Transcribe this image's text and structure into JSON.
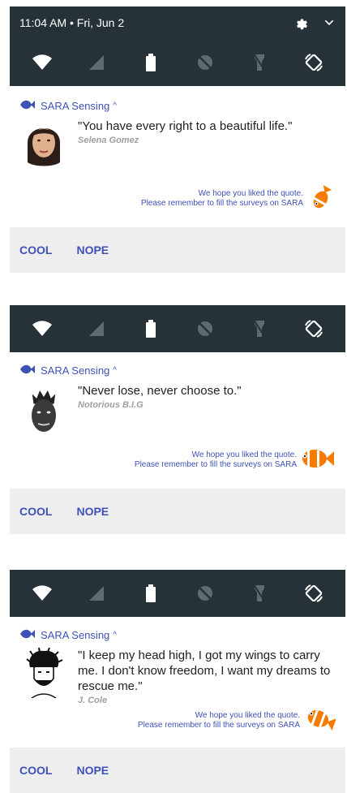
{
  "status": {
    "time": "11:04 AM • Fri, Jun 2"
  },
  "notifications": [
    {
      "app_name": "SARA Sensing",
      "quote": "\"You have every right to a beautiful life.\"",
      "author": "Selena Gomez",
      "footer_line1": "We hope you liked the quote.",
      "footer_line2": "Please remember to fill the surveys on SARA",
      "actions": [
        "COOL",
        "NOPE"
      ]
    },
    {
      "app_name": "SARA Sensing",
      "quote": "\"Never lose, never choose to.\"",
      "author": "Notorious B.I.G",
      "footer_line1": "We hope you liked the quote.",
      "footer_line2": "Please remember to fill the surveys on SARA",
      "actions": [
        "COOL",
        "NOPE"
      ]
    },
    {
      "app_name": "SARA Sensing",
      "quote": "\"I keep my head high, I got my wings to carry me. I don't know freedom, I want my dreams to rescue me.\"",
      "author": "J. Cole",
      "footer_line1": "We hope you liked the quote.",
      "footer_line2": "Please remember to fill the surveys on SARA",
      "actions": [
        "COOL",
        "NOPE"
      ]
    }
  ],
  "colors": {
    "shade": "#263238",
    "accent": "#3f51b5",
    "action_bg": "#eeeeee"
  }
}
